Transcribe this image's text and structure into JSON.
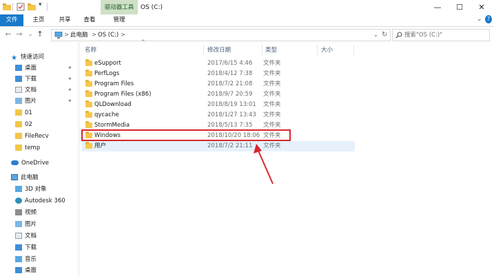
{
  "titlebar": {
    "context_tab": "驱动器工具",
    "title": "OS (C:)",
    "minimize": "—",
    "maximize": "☐",
    "close": "✕"
  },
  "ribbon": {
    "tabs": [
      {
        "label": "文件"
      },
      {
        "label": "主页"
      },
      {
        "label": "共享"
      },
      {
        "label": "查看"
      },
      {
        "label": "管理"
      }
    ]
  },
  "address": {
    "back": "←",
    "forward": "→",
    "recent": "⌄",
    "up": "↑",
    "crumbs": [
      "此电脑",
      "OS (C:)"
    ],
    "separator": ">",
    "dropdown": "⌄",
    "refresh": "↻",
    "search_placeholder": "搜索\"OS (C:)\""
  },
  "sidebar": {
    "quick_access": "快速访问",
    "pinned": [
      {
        "label": "桌面"
      },
      {
        "label": "下载"
      },
      {
        "label": "文档"
      },
      {
        "label": "图片"
      }
    ],
    "folders": [
      {
        "label": "01"
      },
      {
        "label": "02"
      },
      {
        "label": "FileRecv"
      },
      {
        "label": "temp"
      }
    ],
    "onedrive": "OneDrive",
    "this_pc": "此电脑",
    "pc_items": [
      {
        "label": "3D 对象"
      },
      {
        "label": "Autodesk 360"
      },
      {
        "label": "视频"
      },
      {
        "label": "图片"
      },
      {
        "label": "文档"
      },
      {
        "label": "下载"
      },
      {
        "label": "音乐"
      },
      {
        "label": "桌面"
      }
    ]
  },
  "columns": {
    "name": "名称",
    "date": "修改日期",
    "type": "类型",
    "size": "大小"
  },
  "files": [
    {
      "name": "eSupport",
      "date": "2017/6/15 4:46",
      "type": "文件夹"
    },
    {
      "name": "PerfLogs",
      "date": "2018/4/12 7:38",
      "type": "文件夹"
    },
    {
      "name": "Program Files",
      "date": "2018/7/2 21:08",
      "type": "文件夹"
    },
    {
      "name": "Program Files (x86)",
      "date": "2018/9/7 20:59",
      "type": "文件夹"
    },
    {
      "name": "QLDownload",
      "date": "2018/8/19 13:01",
      "type": "文件夹"
    },
    {
      "name": "qycache",
      "date": "2018/1/27 13:43",
      "type": "文件夹"
    },
    {
      "name": "StormMedia",
      "date": "2018/5/13 7:35",
      "type": "文件夹"
    },
    {
      "name": "Windows",
      "date": "2018/10/20 18:06",
      "type": "文件夹"
    },
    {
      "name": "用户",
      "date": "2018/7/2 21:11",
      "type": "文件夹"
    }
  ],
  "colors": {
    "file_tab": "#1979ca",
    "context_tab": "#cfe0c6",
    "highlight": "#d8262c",
    "folder": "#f5c84c",
    "selection": "#e6f1fc"
  }
}
